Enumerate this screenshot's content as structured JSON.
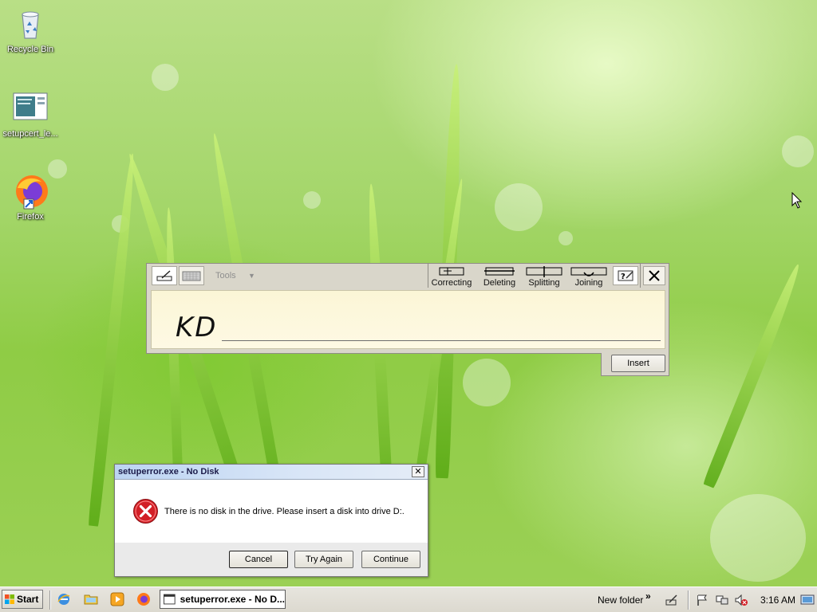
{
  "desktop": {
    "icons": [
      {
        "label": "Recycle Bin",
        "icon": "recycle-bin-icon"
      },
      {
        "label": "setupcert_le...",
        "icon": "document-thumbnail-icon"
      },
      {
        "label": "Firefox",
        "icon": "firefox-icon"
      }
    ]
  },
  "input_panel": {
    "tools_label": "Tools",
    "gestures": [
      {
        "label": "Correcting",
        "icon": "correcting-gesture-icon"
      },
      {
        "label": "Deleting",
        "icon": "deleting-gesture-icon"
      },
      {
        "label": "Splitting",
        "icon": "splitting-gesture-icon"
      },
      {
        "label": "Joining",
        "icon": "joining-gesture-icon"
      }
    ],
    "ink_text": "KD",
    "insert_label": "Insert"
  },
  "dialog": {
    "title": "setuperror.exe - No Disk",
    "message": "There is no disk in the drive. Please insert a disk into drive D:.",
    "close_label": "✕",
    "buttons": {
      "cancel": "Cancel",
      "try_again": "Try Again",
      "continue": "Continue"
    }
  },
  "taskbar": {
    "start_label": "Start",
    "task_button_label": "setuperror.exe - No D...",
    "toolbar_label": "New folder",
    "chevron": "»",
    "clock": "3:16 AM"
  }
}
